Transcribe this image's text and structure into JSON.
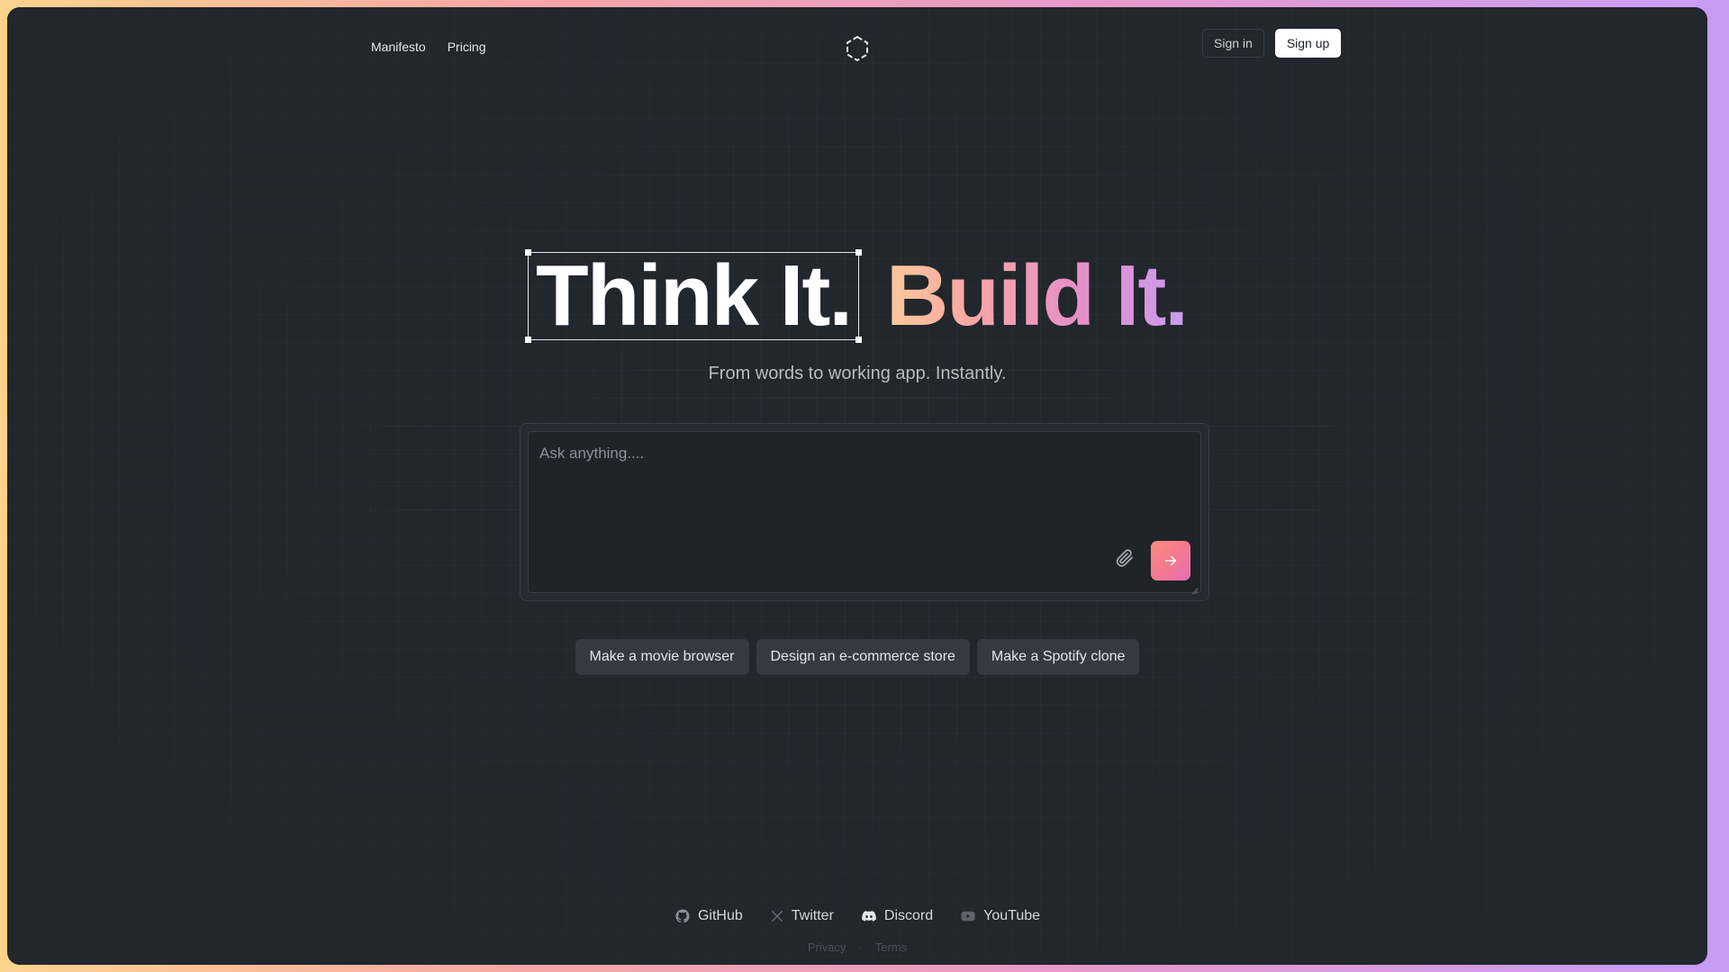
{
  "nav": {
    "links": [
      "Manifesto",
      "Pricing"
    ],
    "sign_in": "Sign in",
    "sign_up": "Sign up",
    "logo_icon": "hexagon-logo-icon"
  },
  "hero": {
    "headline_part1": "Think It.",
    "headline_part2": "Build It.",
    "subtitle": "From words to working app. Instantly."
  },
  "prompt": {
    "placeholder": "Ask anything....",
    "value": "",
    "attach_icon": "paperclip-icon",
    "send_icon": "arrow-right-icon"
  },
  "suggestions": [
    "Make a movie browser",
    "Design an e-commerce store",
    "Make a Spotify clone"
  ],
  "footer": {
    "links": [
      {
        "label": "GitHub",
        "icon": "github-icon"
      },
      {
        "label": "Twitter",
        "icon": "x-icon"
      },
      {
        "label": "Discord",
        "icon": "discord-icon"
      },
      {
        "label": "YouTube",
        "icon": "youtube-icon"
      }
    ],
    "legal": [
      "Privacy",
      "Terms"
    ],
    "separator": "·"
  },
  "colors": {
    "background": "#22262d",
    "border_gradient": [
      "#fbd38d",
      "#f6a6a6",
      "#e99ac7",
      "#c89cf5"
    ],
    "accent_gradient": [
      "#fa8b7d",
      "#e46fb4"
    ],
    "chip_bg": "#353a42"
  }
}
